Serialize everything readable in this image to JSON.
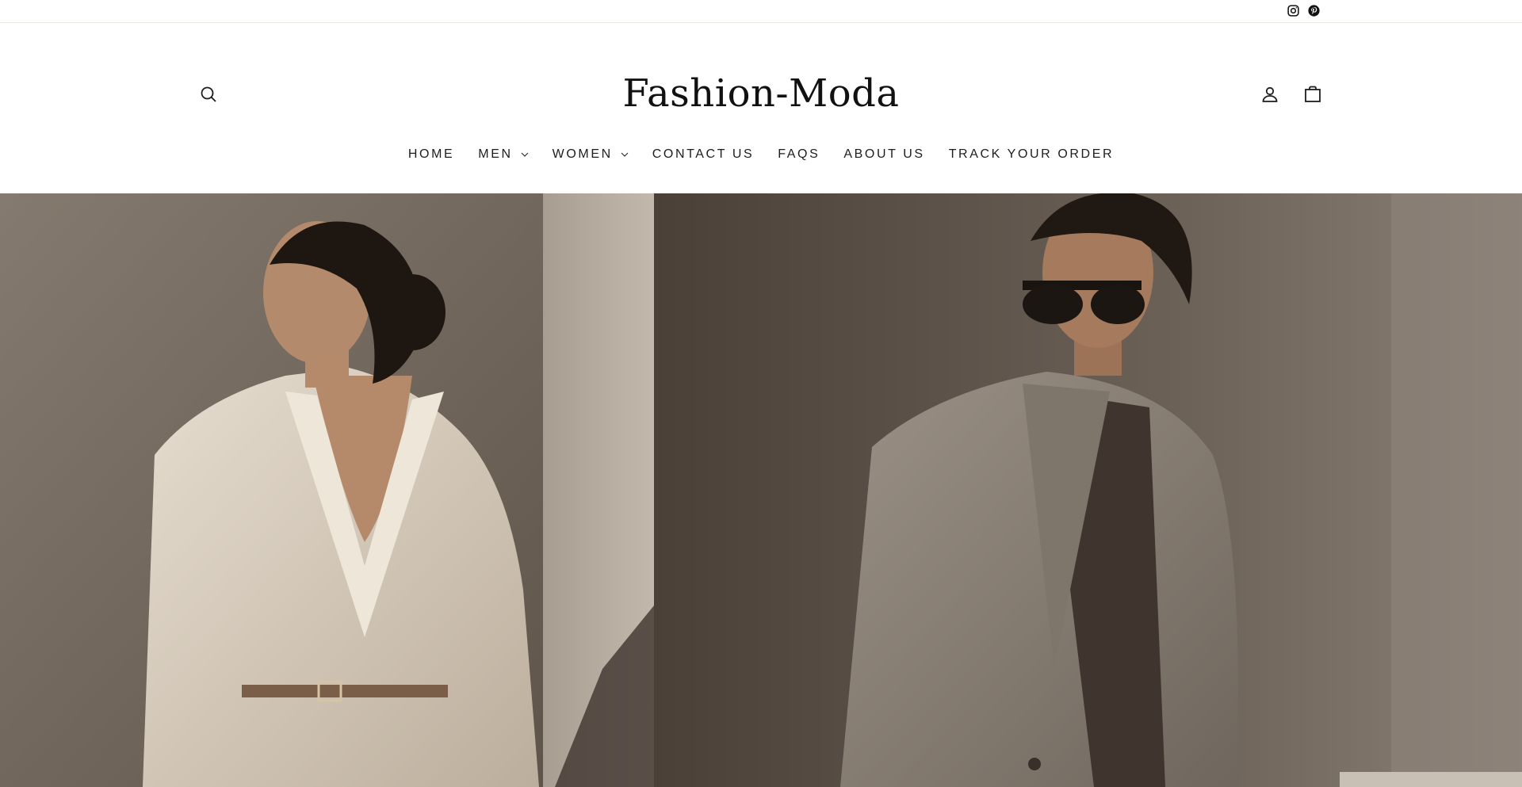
{
  "social": {
    "instagram_icon": "instagram-icon",
    "pinterest_icon": "pinterest-icon"
  },
  "header": {
    "logo": "Fashion-Moda",
    "search_icon": "search-icon",
    "account_icon": "user-icon",
    "cart_icon": "shopping-bag-icon"
  },
  "nav": {
    "items": [
      {
        "label": "HOME",
        "has_dropdown": false
      },
      {
        "label": "MEN",
        "has_dropdown": true
      },
      {
        "label": "WOMEN",
        "has_dropdown": true
      },
      {
        "label": "CONTACT US",
        "has_dropdown": false
      },
      {
        "label": "FAQS",
        "has_dropdown": false
      },
      {
        "label": "ABOUT US",
        "has_dropdown": false
      },
      {
        "label": "TRACK YOUR ORDER",
        "has_dropdown": false
      }
    ]
  },
  "colors": {
    "text": "#1c1d1d",
    "border": "#e8e8e1",
    "background": "#ffffff",
    "hero_wall": "#7a6e62"
  }
}
